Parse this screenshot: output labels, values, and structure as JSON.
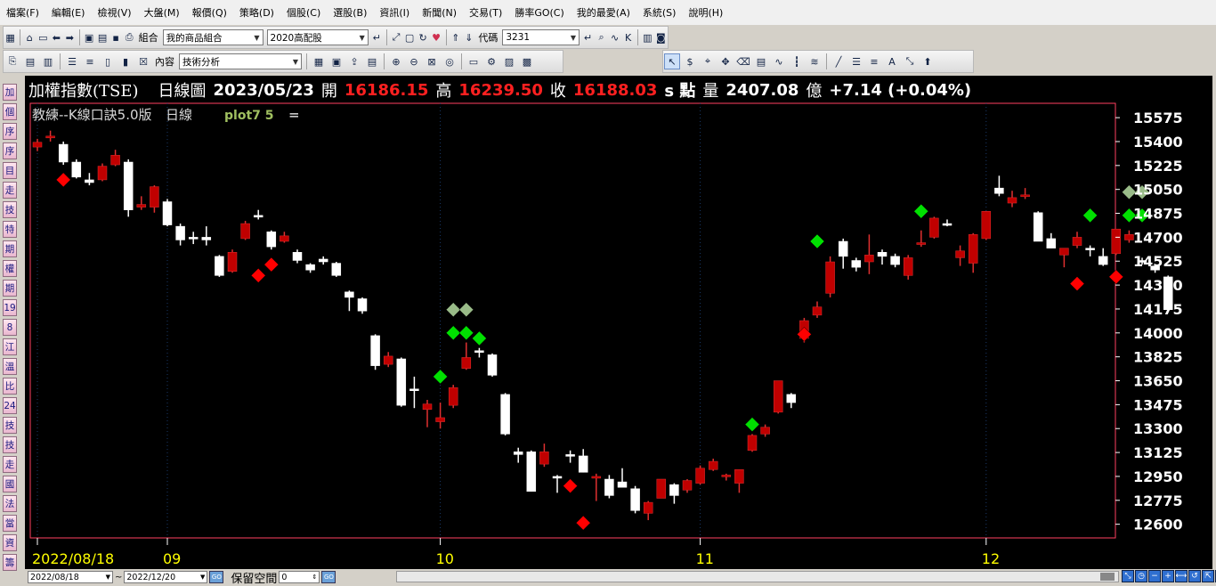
{
  "menu": [
    "檔案(F)",
    "編輯(E)",
    "檢視(V)",
    "大盤(M)",
    "報價(Q)",
    "策略(D)",
    "個股(C)",
    "選股(B)",
    "資訊(I)",
    "新聞(N)",
    "交易(T)",
    "勝率GO(C)",
    "我的最愛(A)",
    "系統(S)",
    "說明(H)"
  ],
  "toolbar1": {
    "group_label": "組合",
    "group_combo": "我的商品組合",
    "portfolio_combo": "2020高配股",
    "code_label": "代碼",
    "code_value": "3231"
  },
  "toolbar2": {
    "content_label": "內容",
    "content_combo": "技術分析"
  },
  "sidebar": [
    "加",
    "個",
    "序",
    "序",
    "目",
    "走",
    "技",
    "特",
    "期",
    "權",
    "期",
    "19",
    "8",
    "江",
    "溫",
    "比",
    "24",
    "技",
    "技",
    "走",
    "國",
    "法",
    "當",
    "資",
    "籌"
  ],
  "header": {
    "name": "加權指數(TSE)",
    "period": "日線圖",
    "date": "2023/05/23",
    "open_label": "開",
    "open": "16186.15",
    "high_label": "高",
    "high": "16239.50",
    "close_label": "收",
    "close": "16188.03",
    "unit": "s 點",
    "vol_label": "量",
    "volume": "2407.08",
    "vol_unit": "億",
    "change": "+7.14 (+0.04%)"
  },
  "indicator": {
    "name": "教練--K線口訣5.0版",
    "period": "日線",
    "plot": "plot7 5",
    "eq": "="
  },
  "colors": {
    "up": "#c00000",
    "down": "#ffffff",
    "sell_signal": "#ff0000",
    "buy_signal": "#00e000",
    "pale_signal": "#99bb88",
    "axis_text": "#ffffff",
    "date_text": "#ffff00",
    "frame": "#ff4060"
  },
  "chart_data": {
    "type": "candlestick",
    "y_ticks": [
      15575,
      15400,
      15225,
      15050,
      14875,
      14700,
      14525,
      14350,
      14175,
      14000,
      13825,
      13650,
      13475,
      13300,
      13125,
      12950,
      12775,
      12600
    ],
    "ylim": [
      12500,
      15680
    ],
    "x_labels": [
      {
        "index": 0,
        "label": "2022/08/18"
      },
      {
        "index": 10,
        "label": "09"
      },
      {
        "index": 31,
        "label": "10"
      },
      {
        "index": 51,
        "label": "11"
      },
      {
        "index": 73,
        "label": "12"
      }
    ],
    "candles": [
      [
        15360,
        15420,
        15330,
        15395
      ],
      [
        15430,
        15480,
        15400,
        15440
      ],
      [
        15380,
        15400,
        15230,
        15250
      ],
      [
        15250,
        15270,
        15130,
        15140
      ],
      [
        15120,
        15170,
        15080,
        15100
      ],
      [
        15120,
        15240,
        15110,
        15220
      ],
      [
        15230,
        15340,
        15220,
        15300
      ],
      [
        15250,
        15270,
        14850,
        14900
      ],
      [
        14920,
        15000,
        14900,
        14940
      ],
      [
        14920,
        15080,
        14880,
        15070
      ],
      [
        14960,
        14980,
        14780,
        14790
      ],
      [
        14780,
        14800,
        14640,
        14680
      ],
      [
        14700,
        14740,
        14650,
        14690
      ],
      [
        14700,
        14780,
        14640,
        14680
      ],
      [
        14560,
        14570,
        14410,
        14420
      ],
      [
        14450,
        14610,
        14440,
        14590
      ],
      [
        14690,
        14820,
        14680,
        14800
      ],
      [
        14860,
        14900,
        14830,
        14850
      ],
      [
        14740,
        14750,
        14610,
        14630
      ],
      [
        14670,
        14740,
        14660,
        14710
      ],
      [
        14590,
        14610,
        14510,
        14530
      ],
      [
        14500,
        14510,
        14440,
        14460
      ],
      [
        14540,
        14560,
        14500,
        14520
      ],
      [
        14510,
        14520,
        14410,
        14420
      ],
      [
        14300,
        14310,
        14160,
        14260
      ],
      [
        14250,
        14260,
        14140,
        14160
      ],
      [
        13980,
        13990,
        13730,
        13760
      ],
      [
        13770,
        13860,
        13750,
        13830
      ],
      [
        13810,
        13820,
        13460,
        13470
      ],
      [
        13590,
        13680,
        13450,
        13580
      ],
      [
        13440,
        13510,
        13310,
        13480
      ],
      [
        13350,
        13490,
        13300,
        13380
      ],
      [
        13470,
        13620,
        13450,
        13600
      ],
      [
        13740,
        13930,
        13730,
        13820
      ],
      [
        13870,
        13890,
        13820,
        13860
      ],
      [
        13840,
        13850,
        13680,
        13690
      ],
      [
        13550,
        13560,
        13250,
        13260
      ],
      [
        13130,
        13160,
        13050,
        13110
      ],
      [
        13130,
        13140,
        12840,
        12840
      ],
      [
        13040,
        13190,
        13020,
        13130
      ],
      [
        12950,
        12960,
        12830,
        12940
      ],
      [
        13110,
        13140,
        13050,
        13100
      ],
      [
        13100,
        13150,
        12980,
        12980
      ],
      [
        12940,
        12970,
        12770,
        12950
      ],
      [
        12930,
        12960,
        12790,
        12810
      ],
      [
        12910,
        13010,
        12880,
        12870
      ],
      [
        12860,
        12880,
        12680,
        12700
      ],
      [
        12680,
        12770,
        12630,
        12760
      ],
      [
        12790,
        12930,
        12790,
        12930
      ],
      [
        12890,
        12900,
        12750,
        12810
      ],
      [
        12850,
        12930,
        12830,
        12920
      ],
      [
        12900,
        13030,
        12890,
        13010
      ],
      [
        13000,
        13080,
        12990,
        13060
      ],
      [
        12950,
        12970,
        12920,
        12960
      ],
      [
        12900,
        13000,
        12830,
        13000
      ],
      [
        13140,
        13260,
        13130,
        13250
      ],
      [
        13260,
        13330,
        13240,
        13310
      ],
      [
        13420,
        13640,
        13410,
        13650
      ],
      [
        13550,
        13560,
        13450,
        13490
      ],
      [
        13960,
        14110,
        13930,
        14090
      ],
      [
        14130,
        14230,
        14110,
        14190
      ],
      [
        14290,
        14560,
        14260,
        14520
      ],
      [
        14670,
        14690,
        14470,
        14560
      ],
      [
        14530,
        14550,
        14450,
        14480
      ],
      [
        14520,
        14720,
        14430,
        14570
      ],
      [
        14590,
        14610,
        14500,
        14560
      ],
      [
        14560,
        14580,
        14480,
        14500
      ],
      [
        14420,
        14570,
        14390,
        14550
      ],
      [
        14650,
        14750,
        14630,
        14660
      ],
      [
        14700,
        14850,
        14690,
        14840
      ],
      [
        14800,
        14830,
        14780,
        14790
      ],
      [
        14550,
        14640,
        14490,
        14600
      ],
      [
        14510,
        14730,
        14440,
        14720
      ],
      [
        14690,
        14890,
        14680,
        14890
      ],
      [
        15060,
        15150,
        15000,
        15020
      ],
      [
        14950,
        15040,
        14920,
        14990
      ],
      [
        15010,
        15060,
        14980,
        15010
      ],
      [
        14880,
        14890,
        14700,
        14670
      ],
      [
        14690,
        14730,
        14620,
        14620
      ],
      [
        14570,
        14610,
        14480,
        14620
      ],
      [
        14640,
        14740,
        14620,
        14700
      ],
      [
        14620,
        14640,
        14560,
        14610
      ],
      [
        14560,
        14620,
        14490,
        14500
      ],
      [
        14580,
        14620,
        14570,
        14760
      ],
      [
        14680,
        14750,
        14660,
        14720
      ],
      [
        14530,
        14550,
        14500,
        14520
      ],
      [
        14490,
        14500,
        14440,
        14460
      ],
      [
        14410,
        14420,
        14160,
        14170
      ]
    ],
    "signals": [
      {
        "index": 2,
        "price": 15120,
        "type": "sell"
      },
      {
        "index": 17,
        "price": 14420,
        "type": "sell"
      },
      {
        "index": 18,
        "price": 14500,
        "type": "sell"
      },
      {
        "index": 31,
        "price": 13680,
        "type": "buy"
      },
      {
        "index": 32,
        "price": 14000,
        "type": "buy"
      },
      {
        "index": 32,
        "price": 14170,
        "type": "pale"
      },
      {
        "index": 33,
        "price": 14000,
        "type": "buy"
      },
      {
        "index": 33,
        "price": 14170,
        "type": "pale"
      },
      {
        "index": 34,
        "price": 13960,
        "type": "buy"
      },
      {
        "index": 41,
        "price": 12880,
        "type": "sell"
      },
      {
        "index": 42,
        "price": 12610,
        "type": "sell"
      },
      {
        "index": 55,
        "price": 13330,
        "type": "buy"
      },
      {
        "index": 59,
        "price": 13990,
        "type": "sell"
      },
      {
        "index": 60,
        "price": 14670,
        "type": "buy"
      },
      {
        "index": 68,
        "price": 14890,
        "type": "buy"
      },
      {
        "index": 80,
        "price": 14360,
        "type": "sell"
      },
      {
        "index": 81,
        "price": 14860,
        "type": "buy"
      },
      {
        "index": 83,
        "price": 14410,
        "type": "sell"
      },
      {
        "index": 84,
        "price": 14860,
        "type": "buy"
      },
      {
        "index": 85,
        "price": 14860,
        "type": "buy"
      },
      {
        "index": 84,
        "price": 15030,
        "type": "pale"
      },
      {
        "index": 85,
        "price": 15030,
        "type": "pale"
      }
    ]
  },
  "bottom": {
    "date_from": "2022/08/18",
    "tilde": "~",
    "date_to": "2022/12/20",
    "go": "GO",
    "keep_label": "保留空間",
    "keep_value": "0"
  }
}
